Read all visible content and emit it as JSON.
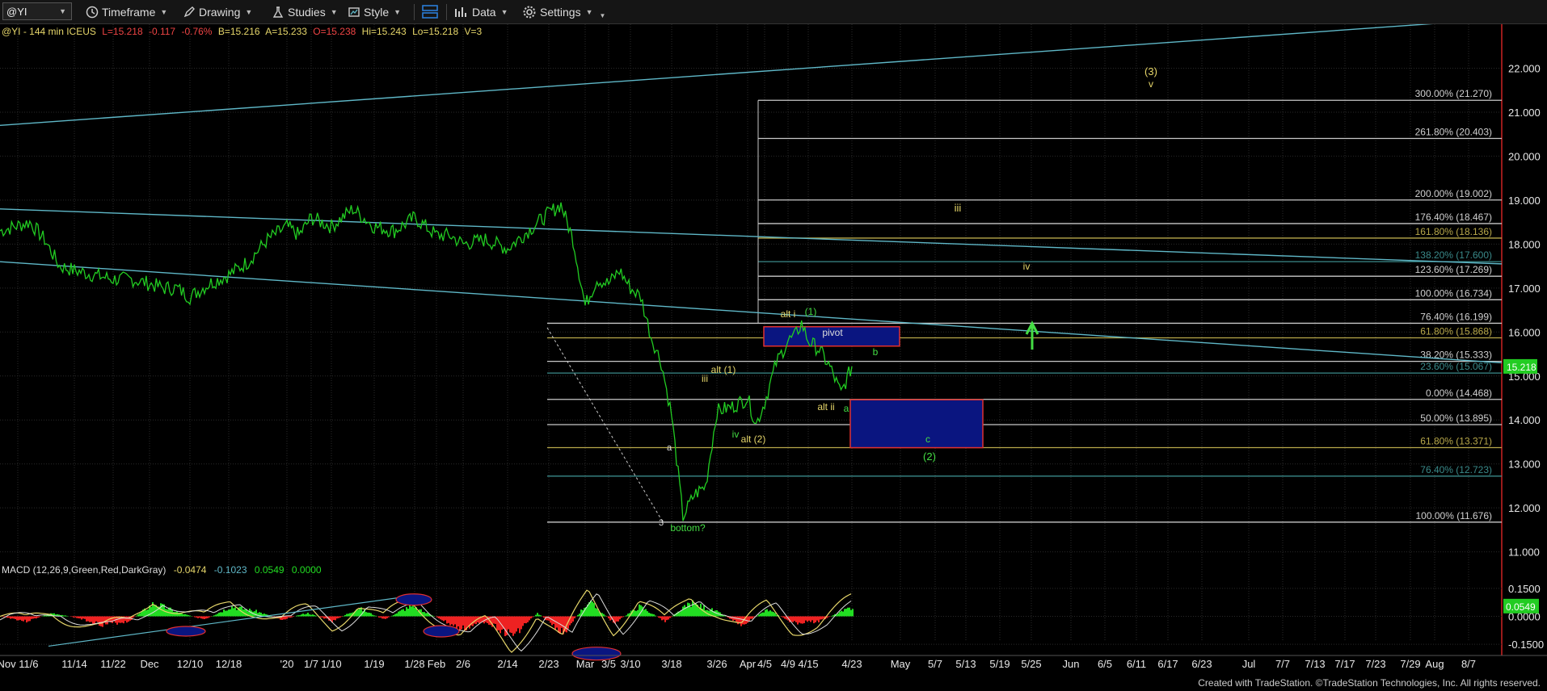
{
  "toolbar": {
    "symbol": "@YI",
    "timeframe": "Timeframe",
    "drawing": "Drawing",
    "studies": "Studies",
    "style": "Style",
    "data": "Data",
    "settings": "Settings"
  },
  "header": {
    "symbol_info": "@YI - 144 min  ICEUS",
    "last": "L=15.218",
    "change": "-0.117",
    "change_pct": "-0.76%",
    "bid": "B=15.216",
    "ask": "A=15.233",
    "open": "O=15.238",
    "high": "Hi=15.243",
    "low": "Lo=15.218",
    "volume": "V=3"
  },
  "colors": {
    "price_line": "#22cc22",
    "trendline": "#5fb8c8",
    "fib_line": "#c8c8c8",
    "wave_label": "#e6d66a",
    "green_label": "#44dd44",
    "box_fill": "#0a1580",
    "box_border": "#e03030",
    "macd_pos": "#22dd22",
    "macd_neg": "#ee2222",
    "last_price_bg": "#22cc22"
  },
  "chart_data": [
    {
      "type": "line",
      "title": "@YI - 144 min ICEUS",
      "y_axis": {
        "range": [
          10.7,
          23.0
        ],
        "ticks": [
          "22.000",
          "21.000",
          "20.000",
          "19.000",
          "18.000",
          "17.000",
          "16.000",
          "15.000",
          "14.000",
          "13.000",
          "12.000",
          "11.000"
        ],
        "values": [
          22,
          21,
          20,
          19,
          18,
          17,
          16,
          15,
          14,
          13,
          12,
          11
        ]
      },
      "x_axis": {
        "ticks": [
          "Nov 11/6",
          "11/14",
          "11/22",
          "Dec",
          "12/10",
          "12/18",
          "'20",
          "1/7",
          "1/10",
          "1/19",
          "1/28",
          "Feb",
          "2/6",
          "2/14",
          "2/23",
          "Mar",
          "3/5",
          "3/10",
          "3/18",
          "3/26",
          "Apr",
          "4/5",
          "4/9",
          "4/15",
          "4/23",
          "May",
          "5/7",
          "5/13",
          "5/19",
          "5/25",
          "Jun",
          "6/5",
          "6/11",
          "6/17",
          "6/23",
          "Jul",
          "7/7",
          "7/13",
          "7/17",
          "7/23",
          "7/29",
          "Aug",
          "8/7"
        ]
      },
      "series": [
        {
          "name": "@YI",
          "x": [
            "11/1",
            "11/3",
            "11/6",
            "11/10",
            "11/14",
            "11/18",
            "11/22",
            "11/26",
            "Dec",
            "12/4",
            "12/7",
            "12/10",
            "12/14",
            "12/18",
            "12/22",
            "12/27",
            "'20",
            "1/4",
            "1/7",
            "1/10",
            "1/14",
            "1/19",
            "1/23",
            "1/28",
            "Feb",
            "2/4",
            "2/6",
            "2/10",
            "2/14",
            "2/18",
            "2/23",
            "2/25",
            "2/27",
            "Mar",
            "3/3",
            "3/5",
            "3/8",
            "3/10",
            "3/12",
            "3/14",
            "3/16",
            "3/18",
            "3/20",
            "3/22",
            "3/24",
            "3/26",
            "3/29",
            "Apr",
            "4/3",
            "4/5",
            "4/7",
            "4/9",
            "4/11",
            "4/13",
            "4/15",
            "4/17",
            "4/19",
            "4/21",
            "4/23"
          ],
          "values": [
            18.3,
            18.5,
            18.1,
            17.5,
            17.4,
            17.3,
            17.2,
            17.2,
            17.1,
            17.0,
            17.0,
            16.8,
            17.1,
            17.3,
            17.6,
            18.1,
            18.4,
            18.2,
            18.6,
            18.4,
            18.8,
            18.4,
            18.3,
            18.6,
            18.2,
            18.2,
            18.0,
            18.1,
            17.9,
            18.3,
            18.7,
            18.9,
            18.1,
            16.6,
            17.2,
            17.1,
            17.4,
            17.0,
            16.8,
            15.9,
            15.3,
            14.1,
            11.8,
            12.3,
            12.5,
            14.2,
            14.3,
            14.5,
            13.9,
            14.4,
            15.3,
            15.8,
            15.9,
            16.2,
            15.8,
            15.6,
            15.2,
            14.6,
            15.218
          ]
        }
      ],
      "fib_levels": [
        {
          "label": "300.00% (21.270)",
          "value": 21.27
        },
        {
          "label": "261.80% (20.403)",
          "value": 20.403
        },
        {
          "label": "200.00% (19.002)",
          "value": 19.002
        },
        {
          "label": "176.40% (18.467)",
          "value": 18.467
        },
        {
          "label": "161.80% (18.136)",
          "value": 18.136
        },
        {
          "label": "138.20% (17.600)",
          "value": 17.6
        },
        {
          "label": "123.60% (17.269)",
          "value": 17.269
        },
        {
          "label": "100.00% (16.734)",
          "value": 16.734
        },
        {
          "label": "76.40% (16.199)",
          "value": 16.199
        },
        {
          "label": "61.80% (15.868)",
          "value": 15.868
        },
        {
          "label": "38.20% (15.333)",
          "value": 15.333
        },
        {
          "label": "23.60% (15.067)",
          "value": 15.067
        },
        {
          "label": "0.00% (14.468)",
          "value": 14.468
        },
        {
          "label": "50.00% (13.895)",
          "value": 13.895
        },
        {
          "label": "61.80% (13.371)",
          "value": 13.371
        },
        {
          "label": "76.40% (12.723)",
          "value": 12.723
        },
        {
          "label": "100.00% (11.676)",
          "value": 11.676
        }
      ],
      "annotations": [
        "(3)",
        "v",
        "iii",
        "iv",
        "alt i",
        "(1)",
        "pivot",
        "b",
        "alt (1)",
        "iii",
        "iv",
        "alt (2)",
        "alt ii",
        "a",
        "c",
        "(2)",
        "a",
        "3",
        "bottom?"
      ],
      "last_price": "15.218"
    },
    {
      "type": "bar",
      "title": "MACD (12,26,9,Green,Red,DarkGray)",
      "values_text": [
        "-0.0474",
        "-0.1023",
        "0.0549",
        "0.0000"
      ],
      "y_axis": {
        "range": [
          -0.21,
          0.21
        ],
        "ticks": [
          "0.1500",
          "0.0000",
          "-0.1500"
        ],
        "values": [
          0.15,
          0,
          -0.15
        ]
      },
      "histogram_anchors": [
        [
          0,
          0
        ],
        [
          0.03,
          -0.03
        ],
        [
          0.06,
          0.02
        ],
        [
          0.09,
          -0.01
        ],
        [
          0.12,
          -0.05
        ],
        [
          0.15,
          -0.03
        ],
        [
          0.18,
          0.08
        ],
        [
          0.21,
          0.02
        ],
        [
          0.24,
          -0.02
        ],
        [
          0.27,
          0.06
        ],
        [
          0.3,
          0.03
        ],
        [
          0.33,
          -0.02
        ],
        [
          0.36,
          0.02
        ],
        [
          0.39,
          -0.03
        ],
        [
          0.42,
          0.05
        ],
        [
          0.45,
          -0.02
        ],
        [
          0.48,
          0.06
        ],
        [
          0.51,
          0.0
        ],
        [
          0.54,
          -0.08
        ],
        [
          0.57,
          -0.03
        ],
        [
          0.6,
          -0.12
        ],
        [
          0.63,
          0.02
        ],
        [
          0.66,
          -0.1
        ],
        [
          0.69,
          0.09
        ],
        [
          0.72,
          -0.04
        ],
        [
          0.75,
          0.06
        ],
        [
          0.78,
          -0.03
        ],
        [
          0.81,
          0.08
        ],
        [
          0.84,
          0.03
        ],
        [
          0.87,
          -0.05
        ],
        [
          0.9,
          0.04
        ],
        [
          0.93,
          -0.04
        ],
        [
          0.96,
          -0.03
        ],
        [
          1.0,
          0.0549
        ]
      ],
      "last_value": "0.0549"
    }
  ],
  "footer": {
    "credit": "Created with TradeStation. ©TradeStation Technologies, Inc. All rights reserved."
  }
}
